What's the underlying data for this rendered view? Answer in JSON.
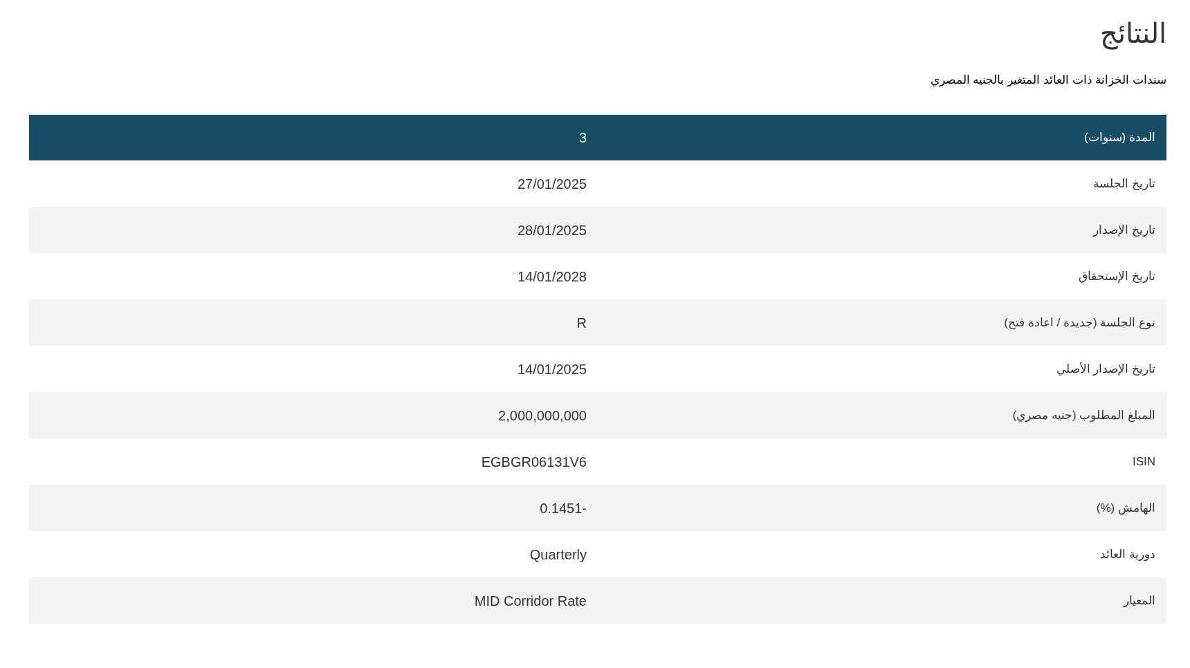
{
  "title": "النتائج",
  "subtitle": "سندات الخزانة ذات العائد المتغير بالجنيه المصري",
  "table": {
    "header": {
      "label": "المدة (سنوات)",
      "value": "3"
    },
    "rows": [
      {
        "label": "تاريخ الجلسة",
        "value": "27/01/2025"
      },
      {
        "label": "تاريخ الإصدار",
        "value": "28/01/2025"
      },
      {
        "label": "تاريخ الإستحقاق",
        "value": "14/01/2028"
      },
      {
        "label": "نوع الجلسة (جديدة / اعادة فتح)",
        "value": "R"
      },
      {
        "label": "تاريخ الإصدار الأصلي",
        "value": "14/01/2025"
      },
      {
        "label": "المبلغ المطلوب (جنيه مصري)",
        "value": "2,000,000,000"
      },
      {
        "label": "ISIN",
        "value": "EGBGR06131V6"
      },
      {
        "label": "الهامش (%)",
        "value": "0.1451-"
      },
      {
        "label": "دورية العائد",
        "value": "Quarterly"
      },
      {
        "label": "المعيار",
        "value": "MID Corridor Rate"
      }
    ]
  }
}
